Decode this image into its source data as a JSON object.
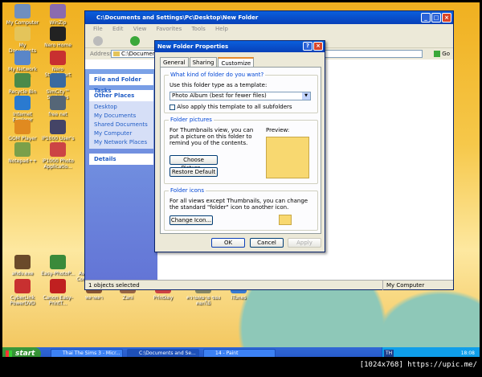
{
  "desktop_icons": [
    {
      "label": "My Computer",
      "color": "#6f8fbf"
    },
    {
      "label": "WinZip",
      "color": "#8a6bb0"
    },
    {
      "label": "My Documents",
      "color": "#e4c45a"
    },
    {
      "label": "Nero Home",
      "color": "#222222"
    },
    {
      "label": "My Network Places",
      "color": "#5a86c8"
    },
    {
      "label": "Nero StartSmart",
      "color": "#c83030"
    },
    {
      "label": "Recycle Bin",
      "color": "#4a8a4a"
    },
    {
      "label": "SimCity™ Societies",
      "color": "#3a6aa0"
    },
    {
      "label": "Internet Explorer",
      "color": "#2a7ad0"
    },
    {
      "label": "free net",
      "color": "#556677"
    },
    {
      "label": "GOM Player",
      "color": "#e08a20"
    },
    {
      "label": "iP1000 User's Guide",
      "color": "#444466"
    },
    {
      "label": "Notepad++",
      "color": "#7aa04a"
    },
    {
      "label": "iP1000 Photo Applicatio...",
      "color": "#cc4444"
    },
    {
      "label": "ahdv.exe",
      "color": "#6a4a2a"
    },
    {
      "label": "Easy-PhotoP...",
      "color": "#3a8a3a"
    },
    {
      "label": "Aviva AntiVir Control Center",
      "color": "#c02020"
    },
    {
      "label": "Google car",
      "color": "#3a7ad0"
    },
    {
      "label": "ลอกไม้",
      "color": "#aa7744"
    },
    {
      "label": "Super Junior ryrics",
      "color": "#886655"
    },
    {
      "label": "iTunesSetup",
      "color": "#5577aa"
    },
    {
      "label": "CyberLink PowerDVD",
      "color": "#c83030"
    },
    {
      "label": "Canon Easy-PrintT...",
      "color": "#c02020"
    },
    {
      "label": "พลาพลา",
      "color": "#885533"
    },
    {
      "label": "Zani",
      "color": "#996644"
    },
    {
      "label": "Printkey",
      "color": "#cc4444"
    },
    {
      "label": "ความหมาย ของดอกไม้",
      "color": "#888866"
    },
    {
      "label": "iTunes",
      "color": "#3a7ad0"
    }
  ],
  "window": {
    "title": "C:\\Documents and Settings\\Pc\\Desktop\\New Folder",
    "menu": [
      "File",
      "Edit",
      "View",
      "Favorites",
      "Tools",
      "Help"
    ],
    "address_label": "Address",
    "address_value": "C:\\Documents",
    "go_label": "Go",
    "tasks_header": "File and Folder Tasks",
    "places_header": "Other Places",
    "places": [
      "Desktop",
      "My Documents",
      "Shared Documents",
      "My Computer",
      "My Network Places"
    ],
    "details_header": "Details",
    "status_left": "1 objects selected",
    "status_right": "My Computer"
  },
  "dialog": {
    "title": "New Folder Properties",
    "help_label": "?",
    "close_label": "×",
    "tabs": [
      "General",
      "Sharing",
      "Customize"
    ],
    "group1_label": "What kind of folder do you want?",
    "template_label": "Use this folder type as a template:",
    "template_value": "Photo Album (best for fewer files)",
    "subfolders_label": "Also apply this template to all subfolders",
    "group2_label": "Folder pictures",
    "pictures_text": "For Thumbnails view, you can put a picture on this folder to remind you of the contents.",
    "preview_label": "Preview:",
    "choose_picture": "Choose Picture...",
    "restore_default": "Restore Default",
    "group3_label": "Folder icons",
    "icons_text": "For all views except Thumbnails, you can change the standard \"folder\" icon to another icon.",
    "change_icon": "Change Icon...",
    "ok": "OK",
    "cancel": "Cancel",
    "apply": "Apply"
  },
  "taskbar": {
    "start": "start",
    "tasks": [
      "Thai The Sims 3 - Micr...",
      "C:\\Documents and Se...",
      "14 - Paint"
    ],
    "lang": "TH",
    "time": "18:08"
  },
  "credit": "[1024x768] https://upic.me/"
}
